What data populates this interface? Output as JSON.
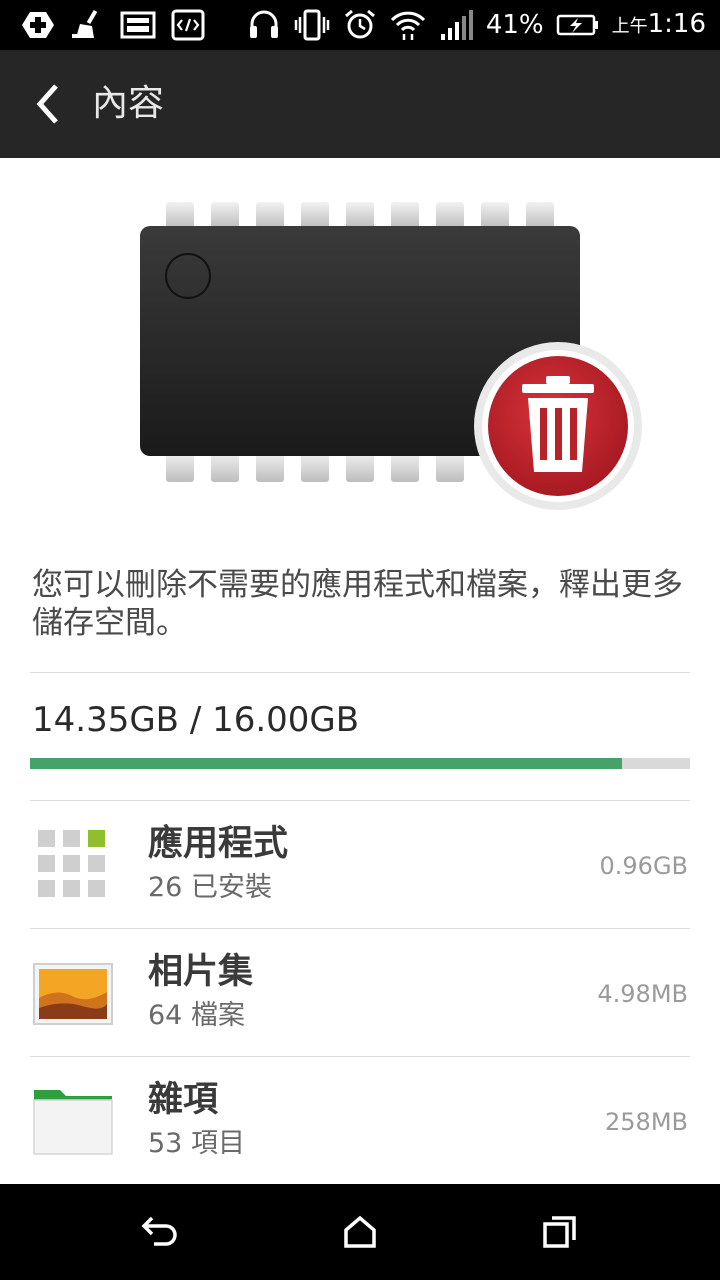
{
  "status_bar": {
    "battery_text": "41%",
    "time_prefix": "上午",
    "time": "1:16"
  },
  "action_bar": {
    "title": "內容"
  },
  "description": "您可以刪除不需要的應用程式和檔案，釋出更多儲存空間。",
  "storage": {
    "usage_text": "14.35GB / 16.00GB",
    "used_fraction": 0.897
  },
  "items": [
    {
      "icon": "apps-grid-icon",
      "title": "應用程式",
      "subtitle": "26 已安裝",
      "size": "0.96GB"
    },
    {
      "icon": "photo-album-icon",
      "title": "相片集",
      "subtitle": "64 檔案",
      "size": "4.98MB"
    },
    {
      "icon": "folder-icon",
      "title": "雜項",
      "subtitle": "53 項目",
      "size": "258MB"
    }
  ],
  "colors": {
    "progress": "#45a36a",
    "accent_chip": "#8fbf2a",
    "trash_red": "#c8242d"
  }
}
